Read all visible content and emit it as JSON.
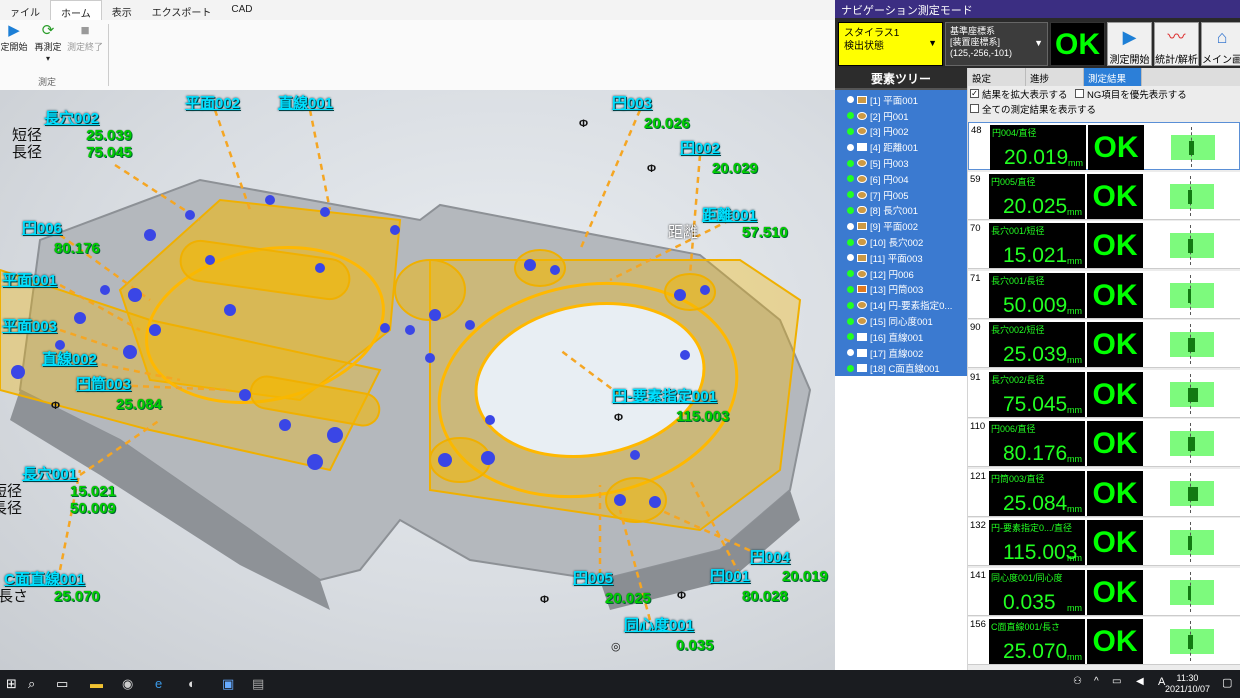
{
  "ribbon": {
    "tabs": [
      "ァイル",
      "ホーム",
      "表示",
      "エクスポート",
      "CAD"
    ],
    "active_tab": "ホーム",
    "buttons": [
      {
        "label": "定開始",
        "icon": "play-icon"
      },
      {
        "label": "再測定",
        "icon": "refresh-icon"
      },
      {
        "label": "測定終了",
        "icon": "stop-icon"
      }
    ],
    "group": "測定"
  },
  "scene": {
    "labels": [
      {
        "id": "l1",
        "name": "長穴002",
        "rows": [
          [
            "短径",
            "25.039"
          ],
          [
            "長径",
            "75.045"
          ]
        ]
      },
      {
        "id": "l2",
        "name": "平面002",
        "rows": []
      },
      {
        "id": "l3",
        "name": "直線001",
        "rows": []
      },
      {
        "id": "l4",
        "name": "円003",
        "rows": [
          [
            "",
            "20.026"
          ]
        ]
      },
      {
        "id": "l5",
        "name": "円002",
        "rows": [
          [
            "",
            "20.029"
          ]
        ]
      },
      {
        "id": "l6",
        "name": "距離001",
        "rows": [
          [
            "距離",
            "57.510"
          ]
        ]
      },
      {
        "id": "l7",
        "name": "円006",
        "rows": [
          [
            "",
            "80.176"
          ]
        ]
      },
      {
        "id": "l8",
        "name": "平面001",
        "rows": []
      },
      {
        "id": "l9",
        "name": "平面003",
        "rows": []
      },
      {
        "id": "l10",
        "name": "直線002",
        "rows": []
      },
      {
        "id": "l11",
        "name": "円筒003",
        "rows": [
          [
            "",
            "25.084"
          ]
        ]
      },
      {
        "id": "l12",
        "name": "円-要素指定001",
        "rows": [
          [
            "",
            "115.003"
          ]
        ]
      },
      {
        "id": "l13",
        "name": "長穴001",
        "rows": [
          [
            "短径",
            "15.021"
          ],
          [
            "長径",
            "50.009"
          ]
        ]
      },
      {
        "id": "l14",
        "name": "C面直線001",
        "rows": [
          [
            "長さ",
            "25.070"
          ]
        ]
      },
      {
        "id": "l15",
        "name": "円004",
        "rows": [
          [
            "",
            "20.019"
          ]
        ]
      },
      {
        "id": "l16",
        "name": "円005",
        "rows": [
          [
            "",
            "20.025"
          ]
        ]
      },
      {
        "id": "l17",
        "name": "円001",
        "rows": [
          [
            "",
            "80.028"
          ]
        ]
      },
      {
        "id": "l18",
        "name": "同心度001",
        "rows": [
          [
            "",
            "0.035"
          ]
        ]
      }
    ],
    "diameter_symbol": "Φ",
    "concentric_symbol": "◎"
  },
  "panel": {
    "title": "ナビゲーション測定モード",
    "stylus": {
      "line1": "スタイラス1",
      "line2": "検出状態"
    },
    "coord": {
      "line1": "基準座標系",
      "line2": "[装置座標系]",
      "line3": "(125,-256,-101)"
    },
    "status": "OK",
    "buttons": [
      {
        "label": "測定開始",
        "icon": "play-icon"
      },
      {
        "label": "統計/解析",
        "icon": "chart-icon"
      },
      {
        "label": "メイン画面",
        "icon": "home-icon"
      }
    ],
    "tree_title": "要素ツリー",
    "tree": [
      "[1] 平面001",
      "[2] 円001",
      "[3] 円002",
      "[4] 距離001",
      "[5] 円003",
      "[6] 円004",
      "[7] 円005",
      "[8] 長穴001",
      "[9] 平面002",
      "[10] 長穴002",
      "[11] 平面003",
      "[12] 円006",
      "[13] 円筒003",
      "[14] 円-要素指定0...",
      "[15] 同心度001",
      "[16] 直線001",
      "[17] 直線002",
      "[18] C面直線001"
    ],
    "tabs": [
      "設定",
      "進捗",
      "測定結果"
    ],
    "active_tab": "測定結果",
    "options": [
      {
        "label": "結果を拡大表示する",
        "checked": true
      },
      {
        "label": "NG項目を優先表示する",
        "checked": false
      },
      {
        "label": "全ての測定結果を表示する",
        "checked": false
      }
    ],
    "results": [
      {
        "num": "48",
        "name": "円004/直径",
        "value": "20.019",
        "unit": "mm",
        "status": "OK",
        "level": 0.55
      },
      {
        "num": "59",
        "name": "円005/直径",
        "value": "20.025",
        "unit": "mm",
        "status": "OK",
        "level": 0.52
      },
      {
        "num": "70",
        "name": "長穴001/短径",
        "value": "15.021",
        "unit": "mm",
        "status": "OK",
        "level": 0.55
      },
      {
        "num": "71",
        "name": "長穴001/長径",
        "value": "50.009",
        "unit": "mm",
        "status": "OK",
        "level": 0.5
      },
      {
        "num": "90",
        "name": "長穴002/短径",
        "value": "25.039",
        "unit": "mm",
        "status": "OK",
        "level": 0.6
      },
      {
        "num": "91",
        "name": "長穴002/長径",
        "value": "75.045",
        "unit": "mm",
        "status": "OK",
        "level": 0.65
      },
      {
        "num": "110",
        "name": "円006/直径",
        "value": "80.176",
        "unit": "mm",
        "status": "OK",
        "level": 0.6
      },
      {
        "num": "121",
        "name": "円筒003/直径",
        "value": "25.084",
        "unit": "mm",
        "status": "OK",
        "level": 0.66
      },
      {
        "num": "132",
        "name": "円-要素指定0.../直径",
        "value": "115.003",
        "unit": "mm",
        "status": "OK",
        "level": 0.52
      },
      {
        "num": "141",
        "name": "同心度001/同心度",
        "value": "0.035",
        "unit": "mm",
        "status": "OK",
        "level": 0.51
      },
      {
        "num": "156",
        "name": "C面直線001/長さ",
        "value": "25.070",
        "unit": "mm",
        "status": "OK",
        "level": 0.55
      }
    ]
  },
  "taskbar": {
    "time": "11:30",
    "date": "2021/10/07",
    "ime": "A"
  }
}
